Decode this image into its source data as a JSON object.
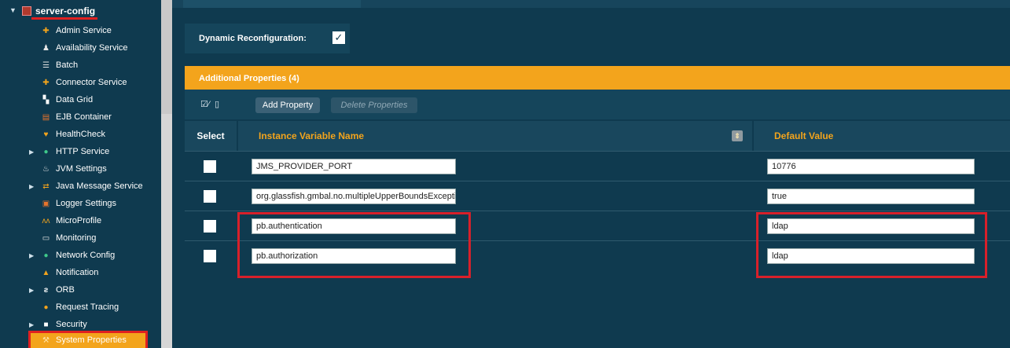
{
  "sidebar": {
    "root": {
      "label": "server-config",
      "icon": "server-config-icon"
    },
    "items": [
      {
        "label": "Admin Service",
        "icon": "admin-service-icon",
        "expandable": false
      },
      {
        "label": "Availability Service",
        "icon": "availability-service-icon",
        "expandable": false
      },
      {
        "label": "Batch",
        "icon": "batch-icon",
        "expandable": false
      },
      {
        "label": "Connector Service",
        "icon": "connector-service-icon",
        "expandable": false
      },
      {
        "label": "Data Grid",
        "icon": "data-grid-icon",
        "expandable": false
      },
      {
        "label": "EJB Container",
        "icon": "ejb-container-icon",
        "expandable": false
      },
      {
        "label": "HealthCheck",
        "icon": "heart-icon",
        "expandable": false
      },
      {
        "label": "HTTP Service",
        "icon": "http-service-icon",
        "expandable": true
      },
      {
        "label": "JVM Settings",
        "icon": "jvm-settings-icon",
        "expandable": false
      },
      {
        "label": "Java Message Service",
        "icon": "java-message-service-icon",
        "expandable": true
      },
      {
        "label": "Logger Settings",
        "icon": "logger-settings-icon",
        "expandable": false
      },
      {
        "label": "MicroProfile",
        "icon": "microprofile-icon",
        "expandable": false
      },
      {
        "label": "Monitoring",
        "icon": "monitoring-icon",
        "expandable": false
      },
      {
        "label": "Network Config",
        "icon": "network-config-icon",
        "expandable": true
      },
      {
        "label": "Notification",
        "icon": "notification-icon",
        "expandable": false
      },
      {
        "label": "ORB",
        "icon": "orb-icon",
        "expandable": true
      },
      {
        "label": "Request Tracing",
        "icon": "request-tracing-icon",
        "expandable": false
      },
      {
        "label": "Security",
        "icon": "lock-icon",
        "expandable": true
      },
      {
        "label": "System Properties",
        "icon": "wrench-icon",
        "expandable": false,
        "selected": true
      }
    ]
  },
  "dynamic_reconfiguration": {
    "label": "Dynamic Reconfiguration:",
    "checked": true,
    "check_glyph": "✓"
  },
  "panel": {
    "title": "Additional Properties (4)"
  },
  "toolbar": {
    "add_label": "Add Property",
    "delete_label": "Delete Properties"
  },
  "table": {
    "headers": {
      "select": "Select",
      "name": "Instance Variable Name",
      "default": "Default Value"
    },
    "rows": [
      {
        "name": "JMS_PROVIDER_PORT",
        "value": "10776",
        "checked": false
      },
      {
        "name": "org.glassfish.gmbal.no.multipleUpperBoundsExcepti",
        "value": "true",
        "checked": false
      },
      {
        "name": "pb.authentication",
        "value": "ldap",
        "checked": false
      },
      {
        "name": "pb.authorization",
        "value": "ldap",
        "checked": false
      }
    ]
  },
  "colors": {
    "accent": "#f3a41c",
    "sidebar_bg": "#0f3a4f",
    "highlight": "#d8202a"
  }
}
